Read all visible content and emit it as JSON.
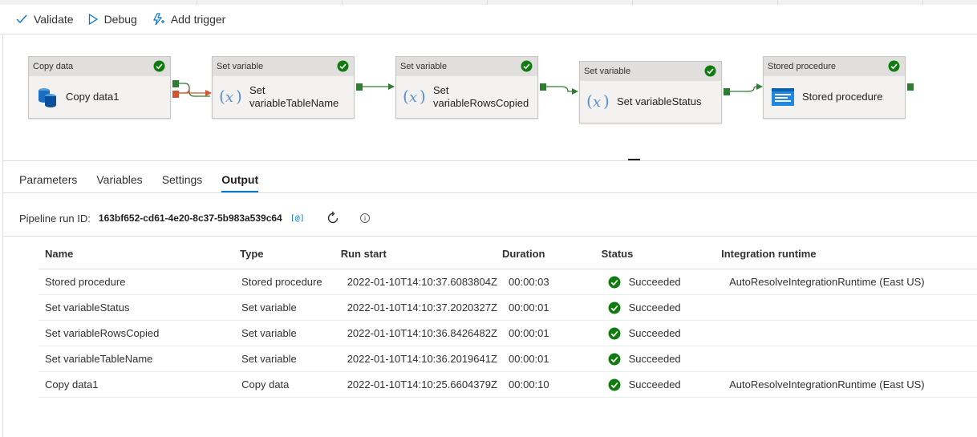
{
  "toolbar": {
    "validate_label": "Validate",
    "debug_label": "Debug",
    "add_trigger_label": "Add trigger"
  },
  "activities": [
    {
      "type": "Copy data",
      "name": "Copy data1",
      "icon": "copy-data-icon"
    },
    {
      "type": "Set variable",
      "name": "Set variableTableName",
      "icon": "variable-icon"
    },
    {
      "type": "Set variable",
      "name": "Set variableRowsCopied",
      "name_line1": "Set",
      "name_line2": "variableRowsCopied",
      "icon": "variable-icon"
    },
    {
      "type": "Set variable",
      "name": "Set variableStatus",
      "icon": "variable-icon"
    },
    {
      "type": "Stored procedure",
      "name": "Stored procedure",
      "icon": "stored-procedure-icon"
    }
  ],
  "tabs": [
    {
      "label": "Parameters",
      "active": false
    },
    {
      "label": "Variables",
      "active": false
    },
    {
      "label": "Settings",
      "active": false
    },
    {
      "label": "Output",
      "active": true
    }
  ],
  "run": {
    "label": "Pipeline run ID:",
    "id": "163bf652-cd61-4e20-8c37-5b983a539c64",
    "copy_icon": "[@]"
  },
  "table": {
    "headers": {
      "name": "Name",
      "type": "Type",
      "run_start": "Run start",
      "duration": "Duration",
      "status": "Status",
      "integration_runtime": "Integration runtime"
    },
    "rows": [
      {
        "name": "Stored procedure",
        "type": "Stored procedure",
        "run_start": "2022-01-10T14:10:37.6083804Z",
        "duration": "00:00:03",
        "status": "Succeeded",
        "integration_runtime": "AutoResolveIntegrationRuntime (East US)"
      },
      {
        "name": "Set variableStatus",
        "type": "Set variable",
        "run_start": "2022-01-10T14:10:37.2020327Z",
        "duration": "00:00:01",
        "status": "Succeeded",
        "integration_runtime": ""
      },
      {
        "name": "Set variableRowsCopied",
        "type": "Set variable",
        "run_start": "2022-01-10T14:10:36.8426482Z",
        "duration": "00:00:01",
        "status": "Succeeded",
        "integration_runtime": ""
      },
      {
        "name": "Set variableTableName",
        "type": "Set variable",
        "run_start": "2022-01-10T14:10:36.2019641Z",
        "duration": "00:00:01",
        "status": "Succeeded",
        "integration_runtime": ""
      },
      {
        "name": "Copy data1",
        "type": "Copy data",
        "run_start": "2022-01-10T14:10:25.6604379Z",
        "duration": "00:00:10",
        "status": "Succeeded",
        "integration_runtime": "AutoResolveIntegrationRuntime (East US)"
      }
    ]
  },
  "colors": {
    "accent": "#0078d4",
    "success": "#107c10",
    "port_success": "#2e7d32",
    "port_failure": "#d0562f"
  }
}
